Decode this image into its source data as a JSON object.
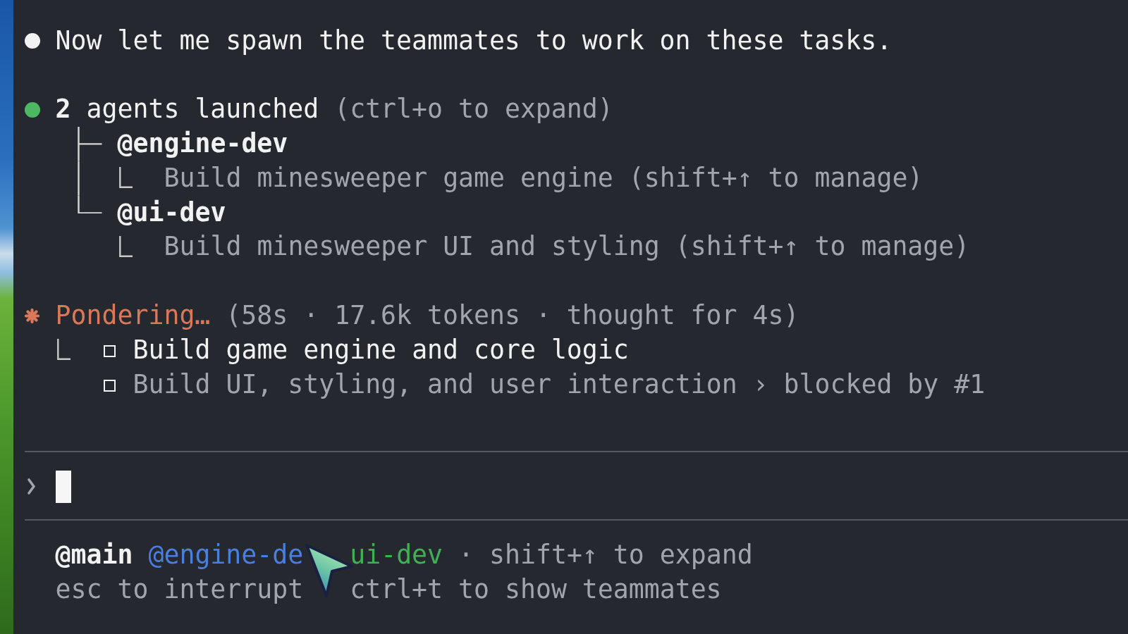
{
  "transcript": [
    {
      "kind": "message",
      "color": "#f2f2f2",
      "text": "Now let me spawn the teammates to work on these tasks."
    },
    {
      "kind": "agents",
      "color": "#4cb862",
      "text": "**2** agents launched",
      "hint": "(ctrl+o to expand)",
      "agents": [
        {
          "name": "@engine-dev",
          "task": "Build minesweeper game engine (shift+↑ to manage)"
        },
        {
          "name": "@ui-dev",
          "task": "Build minesweeper UI and styling (shift+↑ to manage)"
        }
      ]
    }
  ],
  "status": {
    "label": "Pondering…",
    "detail": "(58s · 17.6k tokens · thought for 4s)",
    "todos": [
      {
        "text": "Build game engine and core logic",
        "checked": false,
        "blocked": false
      },
      {
        "text": "Build UI, styling, and user interaction",
        "note": "› blocked by #1",
        "checked": false,
        "blocked": true
      }
    ]
  },
  "prompt": {
    "focused": true
  },
  "teammates": [
    {
      "name": "@main",
      "color": "#f2f2f2",
      "selected": true
    },
    {
      "name": "@engine-de",
      "color": "#4a7fe0",
      "selected": false
    },
    {
      "name": "ui-dev",
      "color": "#3fb055",
      "selected": false
    }
  ],
  "teammates_hint": "· shift+↑ to expand",
  "hints": [
    "esc to interrupt",
    "ctrl+t to show teammates"
  ]
}
